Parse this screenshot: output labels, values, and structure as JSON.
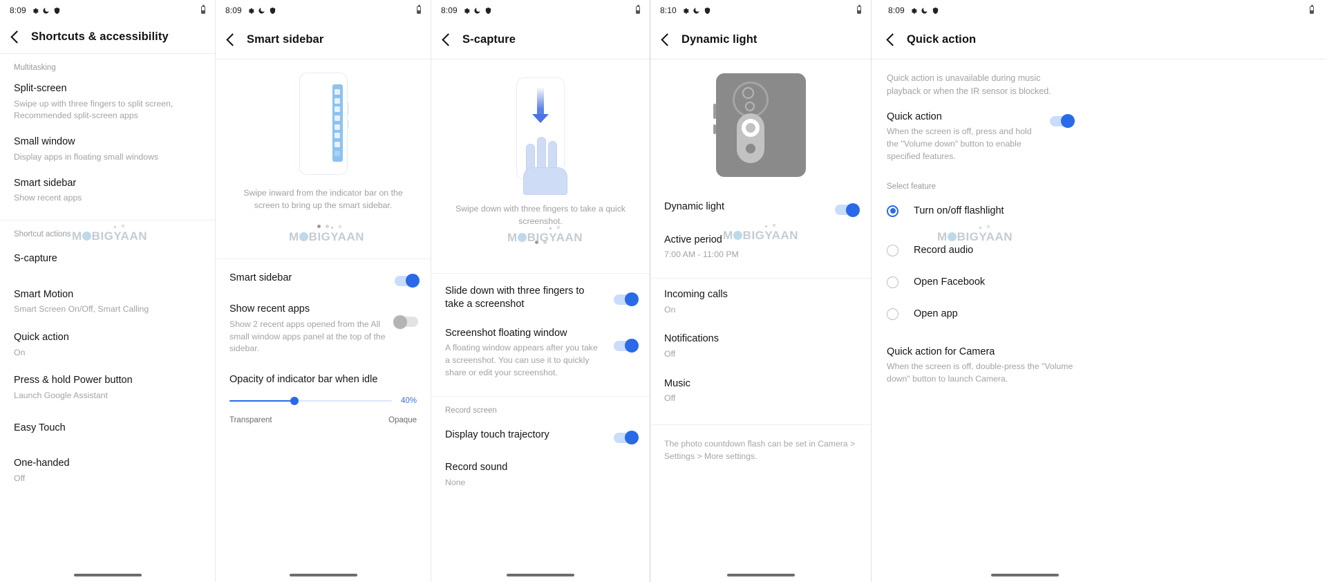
{
  "watermark": "MOBIGYAAN",
  "colors": {
    "accent": "#2a6ae8",
    "toggle_off": "#e2e2e2",
    "text_primary": "#141414",
    "text_secondary": "#a3a3a3"
  },
  "panels": [
    {
      "id": "shortcuts-accessibility",
      "status": {
        "time": "8:09",
        "icons": [
          "gear-icon",
          "moon-icon",
          "shield-icon"
        ],
        "battery": "battery-icon"
      },
      "title": "Shortcuts & accessibility",
      "sections": [
        {
          "label": "Multitasking",
          "items": [
            {
              "title": "Split-screen",
              "sub": "Swipe up with three fingers to split screen, Recommended split-screen apps"
            },
            {
              "title": "Small window",
              "sub": "Display apps in floating small windows"
            },
            {
              "title": "Smart sidebar",
              "sub": "Show recent apps"
            }
          ]
        },
        {
          "label": "Shortcut actions",
          "items": [
            {
              "title": "S-capture",
              "sub": ""
            },
            {
              "title": "Smart Motion",
              "sub": "Smart Screen On/Off, Smart Calling"
            },
            {
              "title": "Quick action",
              "sub": "On"
            },
            {
              "title": "Press & hold Power button",
              "sub": "Launch Google Assistant"
            },
            {
              "title": "Easy Touch",
              "sub": ""
            },
            {
              "title": "One-handed",
              "sub": "Off"
            }
          ]
        }
      ]
    },
    {
      "id": "smart-sidebar",
      "status": {
        "time": "8:09",
        "icons": [
          "gear-icon",
          "moon-icon",
          "shield-icon"
        ],
        "battery": "battery-icon"
      },
      "title": "Smart sidebar",
      "caption": "Swipe inward from the indicator bar on the screen to bring up the smart sidebar.",
      "items": [
        {
          "title": "Smart sidebar",
          "sub": "",
          "toggle": "on"
        },
        {
          "title": "Show recent apps",
          "sub": "Show 2 recent apps opened from the All small window apps panel at the top of the sidebar.",
          "toggle": "off"
        }
      ],
      "slider": {
        "label": "Opacity of indicator bar when idle",
        "value": "40%",
        "percent": 40,
        "min_label": "Transparent",
        "max_label": "Opaque"
      }
    },
    {
      "id": "s-capture",
      "status": {
        "time": "8:09",
        "icons": [
          "gear-icon",
          "moon-icon",
          "shield-icon"
        ],
        "battery": "battery-icon"
      },
      "title": "S-capture",
      "caption": "Swipe down with three fingers to take a quick screenshot.",
      "items": [
        {
          "title": "Slide down with three fingers to take a screenshot",
          "sub": "",
          "toggle": "on"
        },
        {
          "title": "Screenshot floating window",
          "sub": "A floating window appears after you take a screenshot. You can use it to quickly share or edit your screenshot.",
          "toggle": "on"
        }
      ],
      "section_label": "Record screen",
      "record_items": [
        {
          "title": "Display touch trajectory",
          "sub": "",
          "toggle": "on"
        },
        {
          "title": "Record sound",
          "sub": "None",
          "toggle": ""
        }
      ]
    },
    {
      "id": "dynamic-light",
      "status": {
        "time": "8:10",
        "icons": [
          "gear-icon",
          "moon-icon",
          "shield-icon"
        ],
        "battery": "battery-icon"
      },
      "title": "Dynamic light",
      "items": [
        {
          "title": "Dynamic light",
          "sub": "",
          "toggle": "on"
        },
        {
          "title": "Active period",
          "sub": "7:00 AM - 11:00 PM",
          "toggle": ""
        },
        {
          "title": "Incoming calls",
          "sub": "On",
          "toggle": ""
        },
        {
          "title": "Notifications",
          "sub": "Off",
          "toggle": ""
        },
        {
          "title": "Music",
          "sub": "Off",
          "toggle": ""
        }
      ],
      "footnote": "The photo countdown flash can be set in Camera > Settings > More settings."
    },
    {
      "id": "quick-action",
      "status": {
        "time": "8:09",
        "icons": [
          "gear-icon",
          "moon-icon",
          "shield-icon"
        ],
        "battery": "battery-icon"
      },
      "title": "Quick action",
      "intro": "Quick action is unavailable during music playback or when the IR sensor is blocked.",
      "main_item": {
        "title": "Quick action",
        "sub": "When the screen is off, press and hold the \"Volume down\" button to enable specified features.",
        "toggle": "on"
      },
      "select_label": "Select feature",
      "options": [
        {
          "label": "Turn on/off flashlight",
          "selected": true
        },
        {
          "label": "Record audio",
          "selected": false
        },
        {
          "label": "Open Facebook",
          "selected": false
        },
        {
          "label": "Open app",
          "selected": false
        }
      ],
      "camera_section": {
        "title": "Quick action for Camera",
        "sub": "When the screen is off, double-press the \"Volume down\" button to launch Camera."
      }
    }
  ]
}
